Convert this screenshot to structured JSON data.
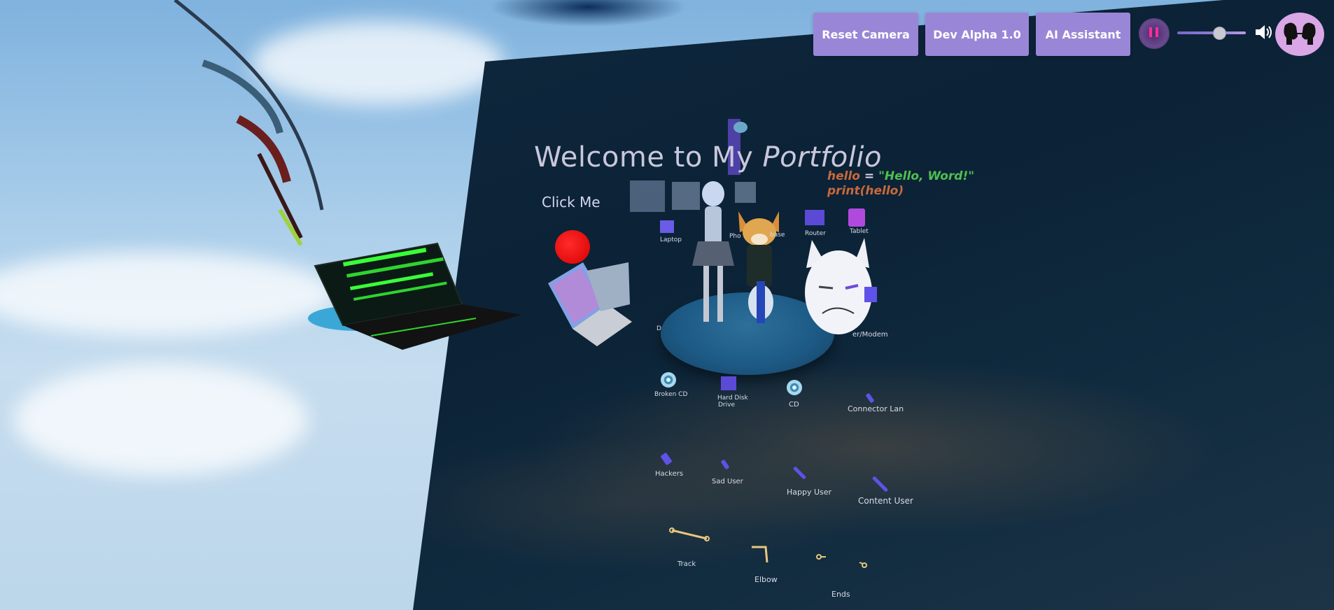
{
  "toolbar": {
    "reset_camera_label": "Reset Camera",
    "dev_label": "Dev Alpha 1.0",
    "ai_assistant_label": "AI Assistant",
    "volume_level": 0.6,
    "button_color": "#9a86d6",
    "pause_color": "#ff2c9a",
    "avatar_color": "#d9a6e6"
  },
  "scene": {
    "title_plain": "Welcome to My ",
    "title_italic": "Portfolio",
    "click_me": "Click Me",
    "code_line1_var": "hello",
    "code_line1_op": " = ",
    "code_line1_str": "\"Hello, Word!\"",
    "code_line2": "print(hello)",
    "labels": {
      "laptop": "Laptop",
      "phone": "Pho",
      "database": "base",
      "router": "Router",
      "tablet": "Tablet",
      "modem": "er/Modem",
      "broken_cd": "Broken CD",
      "hard_disk": "Hard Disk",
      "hard_disk_2": "Drive",
      "cd": "CD",
      "connector": "Connector Lan",
      "hackers": "Hackers",
      "sad_user": "Sad User",
      "happy_user": "Happy User",
      "content_user": "Content User",
      "track": "Track",
      "elbow": "Elbow",
      "ends": "Ends",
      "d": "D"
    }
  }
}
